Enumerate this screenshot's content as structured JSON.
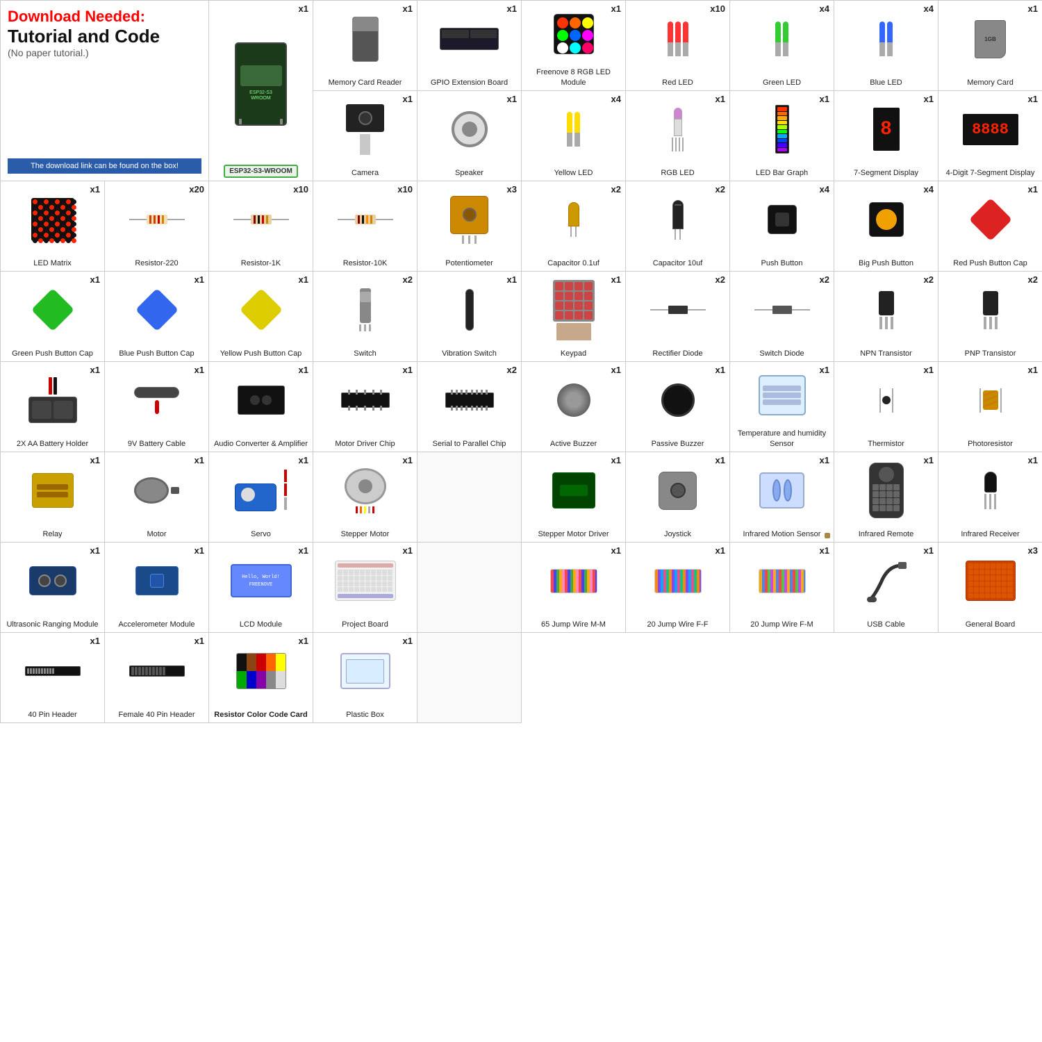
{
  "intro": {
    "download_text": "Download Needed:",
    "title": "Tutorial and Code",
    "note": "(No paper tutorial.)",
    "banner": "The download link can be found on the box!",
    "esp_label": "ESP32-S3-WROOM"
  },
  "components": [
    {
      "id": "esp32",
      "qty": "x1",
      "label": "ESP32-S3-WROOM",
      "shape": "board",
      "col_span": 1
    },
    {
      "id": "memory-card-reader",
      "qty": "x1",
      "label": "Memory Card Reader",
      "shape": "card-reader"
    },
    {
      "id": "gpio-extension",
      "qty": "x1",
      "label": "GPIO Extension Board",
      "shape": "gpio"
    },
    {
      "id": "freenove-rgb",
      "qty": "x1",
      "label": "Freenove 8 RGB LED Module",
      "shape": "rgb-module"
    },
    {
      "id": "red-led",
      "qty": "x10",
      "label": "Red LED",
      "shape": "led-red"
    },
    {
      "id": "green-led",
      "qty": "x4",
      "label": "Green LED",
      "shape": "led-green"
    },
    {
      "id": "blue-led",
      "qty": "x4",
      "label": "Blue LED",
      "shape": "led-blue"
    },
    {
      "id": "memory-card",
      "qty": "x1",
      "label": "Memory Card",
      "shape": "memory-card"
    },
    {
      "id": "camera",
      "qty": "x1",
      "label": "Camera",
      "shape": "camera"
    },
    {
      "id": "speaker",
      "qty": "x1",
      "label": "Speaker",
      "shape": "speaker"
    },
    {
      "id": "yellow-led",
      "qty": "x4",
      "label": "Yellow LED",
      "shape": "led-yellow"
    },
    {
      "id": "rgb-led",
      "qty": "x1",
      "label": "RGB LED",
      "shape": "rgb-led"
    },
    {
      "id": "led-bar-graph",
      "qty": "x1",
      "label": "LED\nBar Graph",
      "shape": "led-bar"
    },
    {
      "id": "7seg",
      "qty": "x1",
      "label": "7-Segment Display",
      "shape": "7seg"
    },
    {
      "id": "4dig-7seg",
      "qty": "x1",
      "label": "4-Digit 7-Segment Display",
      "shape": "4dig-7seg"
    },
    {
      "id": "led-matrix",
      "qty": "x1",
      "label": "LED Matrix",
      "shape": "led-matrix"
    },
    {
      "id": "resistor-220",
      "qty": "x20",
      "label": "Resistor-220",
      "shape": "resistor"
    },
    {
      "id": "resistor-1k",
      "qty": "x10",
      "label": "Resistor-1K",
      "shape": "resistor-1k"
    },
    {
      "id": "resistor-10k",
      "qty": "x10",
      "label": "Resistor-10K",
      "shape": "resistor-10k"
    },
    {
      "id": "potentiometer",
      "qty": "x3",
      "label": "Potentiometer",
      "shape": "potentiometer"
    },
    {
      "id": "capacitor-01",
      "qty": "x2",
      "label": "Capacitor 0.1uf",
      "shape": "capacitor-sm"
    },
    {
      "id": "capacitor-10",
      "qty": "x2",
      "label": "Capacitor 10uf",
      "shape": "capacitor-lg"
    },
    {
      "id": "push-btn",
      "qty": "x4",
      "label": "Push Button",
      "shape": "push-btn"
    },
    {
      "id": "big-push-btn",
      "qty": "x4",
      "label": "Big Push Button",
      "shape": "push-btn-big"
    },
    {
      "id": "red-cap",
      "qty": "x1",
      "label": "Red Push Button Cap",
      "shape": "push-cap-red"
    },
    {
      "id": "green-cap",
      "qty": "x1",
      "label": "Green Push Button Cap",
      "shape": "push-cap-green"
    },
    {
      "id": "blue-cap",
      "qty": "x1",
      "label": "Blue Push Button Cap",
      "shape": "push-cap-blue"
    },
    {
      "id": "yellow-cap",
      "qty": "x1",
      "label": "Yellow Push Button Cap",
      "shape": "push-cap-yellow"
    },
    {
      "id": "switch",
      "qty": "x2",
      "label": "Switch",
      "shape": "switch"
    },
    {
      "id": "vib-switch",
      "qty": "x1",
      "label": "Vibration Switch",
      "shape": "vib-switch"
    },
    {
      "id": "keypad",
      "qty": "x1",
      "label": "Keypad",
      "shape": "keypad"
    },
    {
      "id": "rect-diode",
      "qty": "x2",
      "label": "Rectifier Diode",
      "shape": "diode"
    },
    {
      "id": "switch-diode",
      "qty": "x2",
      "label": "Switch Diode",
      "shape": "diode"
    },
    {
      "id": "npn-trans",
      "qty": "x2",
      "label": "NPN Transistor",
      "shape": "transistor-npn"
    },
    {
      "id": "pnp-trans",
      "qty": "x2",
      "label": "PNP Transistor",
      "shape": "transistor-pnp"
    },
    {
      "id": "battery-holder",
      "qty": "x1",
      "label": "2X AA Battery Holder",
      "shape": "battery-holder"
    },
    {
      "id": "battery-cable",
      "qty": "x1",
      "label": "9V Battery Cable",
      "shape": "battery-cable"
    },
    {
      "id": "audio-converter",
      "qty": "x1",
      "label": "Audio Converter & Amplifier",
      "shape": "audio-converter"
    },
    {
      "id": "motor-driver",
      "qty": "x1",
      "label": "Motor Driver Chip",
      "shape": "motor-driver"
    },
    {
      "id": "serial-chip",
      "qty": "x2",
      "label": "Serial to Parallel Chip",
      "shape": "serial-chip"
    },
    {
      "id": "active-buzzer",
      "qty": "x1",
      "label": "Active Buzzer",
      "shape": "buzzer-active"
    },
    {
      "id": "passive-buzzer",
      "qty": "x1",
      "label": "Passive Buzzer",
      "shape": "buzzer-passive"
    },
    {
      "id": "temp-sensor",
      "qty": "x1",
      "label": "Temperature and humidity Sensor",
      "shape": "temp-sensor"
    },
    {
      "id": "thermistor",
      "qty": "x1",
      "label": "Thermistor",
      "shape": "thermistor"
    },
    {
      "id": "photoresistor",
      "qty": "x1",
      "label": "Photoresistor",
      "shape": "photoresistor"
    },
    {
      "id": "relay",
      "qty": "x1",
      "label": "Relay",
      "shape": "relay"
    },
    {
      "id": "motor",
      "qty": "x1",
      "label": "Motor",
      "shape": "motor"
    },
    {
      "id": "servo",
      "qty": "x1",
      "label": "Servo",
      "shape": "servo"
    },
    {
      "id": "stepper-motor",
      "qty": "x1",
      "label": "Stepper Motor",
      "shape": "stepper-motor"
    },
    {
      "id": "stepper-driver",
      "qty": "x1",
      "label": "Stepper Motor Driver",
      "shape": "stepper-driver"
    },
    {
      "id": "joystick",
      "qty": "x1",
      "label": "Joystick",
      "shape": "joystick"
    },
    {
      "id": "ir-sensor",
      "qty": "x1",
      "label": "Infrared Motion Sensor",
      "shape": "ir-sensor"
    },
    {
      "id": "ir-remote",
      "qty": "x1",
      "label": "Infrared Remote",
      "shape": "ir-remote"
    },
    {
      "id": "ir-receiver",
      "qty": "x1",
      "label": "Infrared Receiver",
      "shape": "ir-receiver"
    },
    {
      "id": "ultrasonic",
      "qty": "x1",
      "label": "Ultrasonic Ranging Module",
      "shape": "ultrasonic"
    },
    {
      "id": "accelerometer",
      "qty": "x1",
      "label": "Accelerometer Module",
      "shape": "accelerometer"
    },
    {
      "id": "lcd",
      "qty": "x1",
      "label": "LCD Module",
      "shape": "lcd"
    },
    {
      "id": "breadboard",
      "qty": "x1",
      "label": "Project Board",
      "shape": "breadboard"
    },
    {
      "id": "jump-mm",
      "qty": "x1",
      "label": "65 Jump Wire M-M",
      "shape": "jump-mm"
    },
    {
      "id": "jump-ff",
      "qty": "x1",
      "label": "20 Jump Wire F-F",
      "shape": "jump-ff"
    },
    {
      "id": "jump-fm",
      "qty": "x1",
      "label": "20 Jump Wire F-M",
      "shape": "jump-fm"
    },
    {
      "id": "usb-cable",
      "qty": "x1",
      "label": "USB Cable",
      "shape": "usb-cable"
    },
    {
      "id": "general-board",
      "qty": "x3",
      "label": "General Board",
      "shape": "general-board"
    },
    {
      "id": "pin-header",
      "qty": "x1",
      "label": "40 Pin Header",
      "shape": "pin-header"
    },
    {
      "id": "female-header",
      "qty": "x1",
      "label": "Female 40 Pin Header",
      "shape": "female-header"
    },
    {
      "id": "color-card",
      "qty": "x1",
      "label": "Resistor Color Code Card",
      "shape": "color-card"
    },
    {
      "id": "plastic-box",
      "qty": "x1",
      "label": "Plastic Box",
      "shape": "plastic-box"
    }
  ]
}
